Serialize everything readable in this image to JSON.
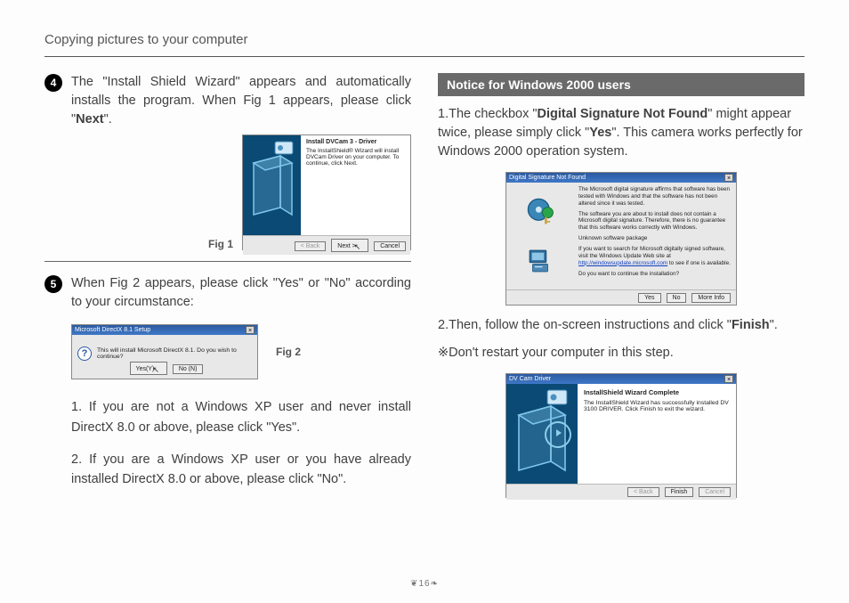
{
  "header": {
    "title": "Copying pictures to your computer"
  },
  "left": {
    "step4": {
      "num": "4",
      "text_a": "The \"Install Shield Wizard\" appears and automatically installs the program. When Fig 1 appears, please click \"",
      "bold": "Next",
      "text_b": "\"."
    },
    "fig1_label": "Fig 1",
    "fig1_dialog": {
      "title": "Install DVCam 3 - Driver",
      "line1": "The InstallShield® Wizard will install DVCam Driver on your computer. To continue, click Next.",
      "btn_back": "< Back",
      "btn_next": "Next >",
      "btn_cancel": "Cancel"
    },
    "step5": {
      "num": "5",
      "text": "When Fig 2 appears, please click \"Yes\" or \"No\" according to your circumstance:"
    },
    "fig2_label": "Fig 2",
    "fig2_dialog": {
      "title": "Microsoft DirectX 8.1 Setup",
      "text": "This will install Microsoft DirectX 8.1. Do you wish to continue?",
      "btn_yes": "Yes(Y)",
      "btn_no": "No (N)"
    },
    "sub1": "1. If you are not a Windows XP user and never install DirectX 8.0 or above, please click \"Yes\".",
    "sub2": "2. If you are a Windows XP user or you have already installed DirectX 8.0 or above, please click  \"No\"."
  },
  "right": {
    "notice_header": "Notice for Windows 2000 users",
    "p1_a": "1.The checkbox \"",
    "p1_bold1": "Digital Signature Not Found",
    "p1_b": "\" might appear twice, please simply click \"",
    "p1_bold2": "Yes",
    "p1_c": "\". This camera works perfectly for Windows 2000 operation system.",
    "dsig_dialog": {
      "title": "Digital Signature Not Found",
      "l1": "The Microsoft digital signature affirms that software has been tested with Windows and that the software has not been altered since it was tested.",
      "l2": "The software you are about to install does not contain a Microsoft digital signature. Therefore, there is no guarantee that this software works correctly with Windows.",
      "l3": "Unknown software package",
      "l4a": "If you want to search for Microsoft digitally signed software, visit the Windows Update Web site at ",
      "l4link": "http://windowsupdate.microsoft.com",
      "l4b": " to see if one is available.",
      "l5": "Do you want to continue the installation?",
      "btn_yes": "Yes",
      "btn_no": "No",
      "btn_more": "More Info"
    },
    "p2_a": "2.Then, follow the on-screen instructions and click \"",
    "p2_bold": "Finish",
    "p2_b": "\".",
    "p3": "※Don't restart your computer in this step.",
    "finish_dialog": {
      "title": "DV Cam Driver",
      "heading": "InstallShield Wizard Complete",
      "body": "The InstallShield Wizard has successfully installed DV 3100 DRIVER. Click Finish to exit the wizard.",
      "btn_back": "< Back",
      "btn_finish": "Finish",
      "btn_cancel": "Cancel"
    }
  },
  "page_number": "16"
}
